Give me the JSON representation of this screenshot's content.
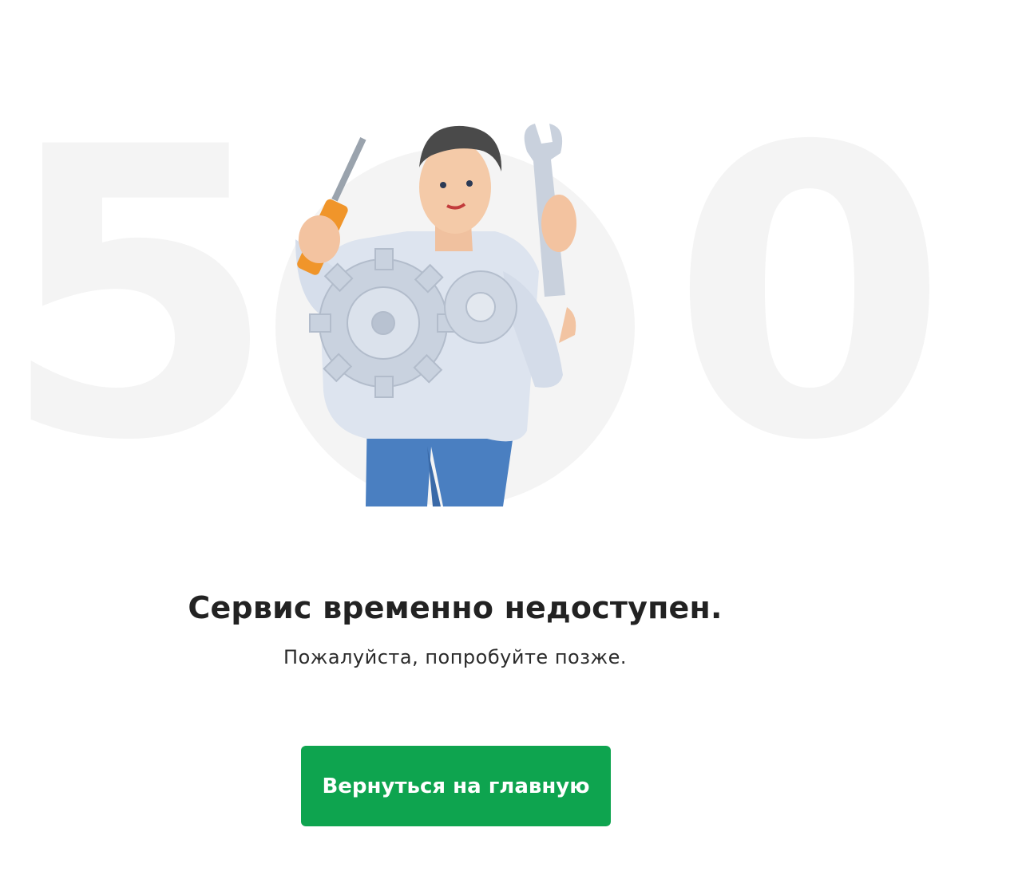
{
  "background": {
    "digit_left": "5",
    "digit_right": "0",
    "digit_color": "#f4f4f4"
  },
  "illustration": {
    "description_icon": "repairman-with-gears-icon"
  },
  "message": {
    "title": "Сервис временно недоступен.",
    "subtitle": "Пожалуйста, попробуйте позже."
  },
  "actions": {
    "home_label": "Вернуться на главную",
    "home_color": "#0ea44f"
  }
}
